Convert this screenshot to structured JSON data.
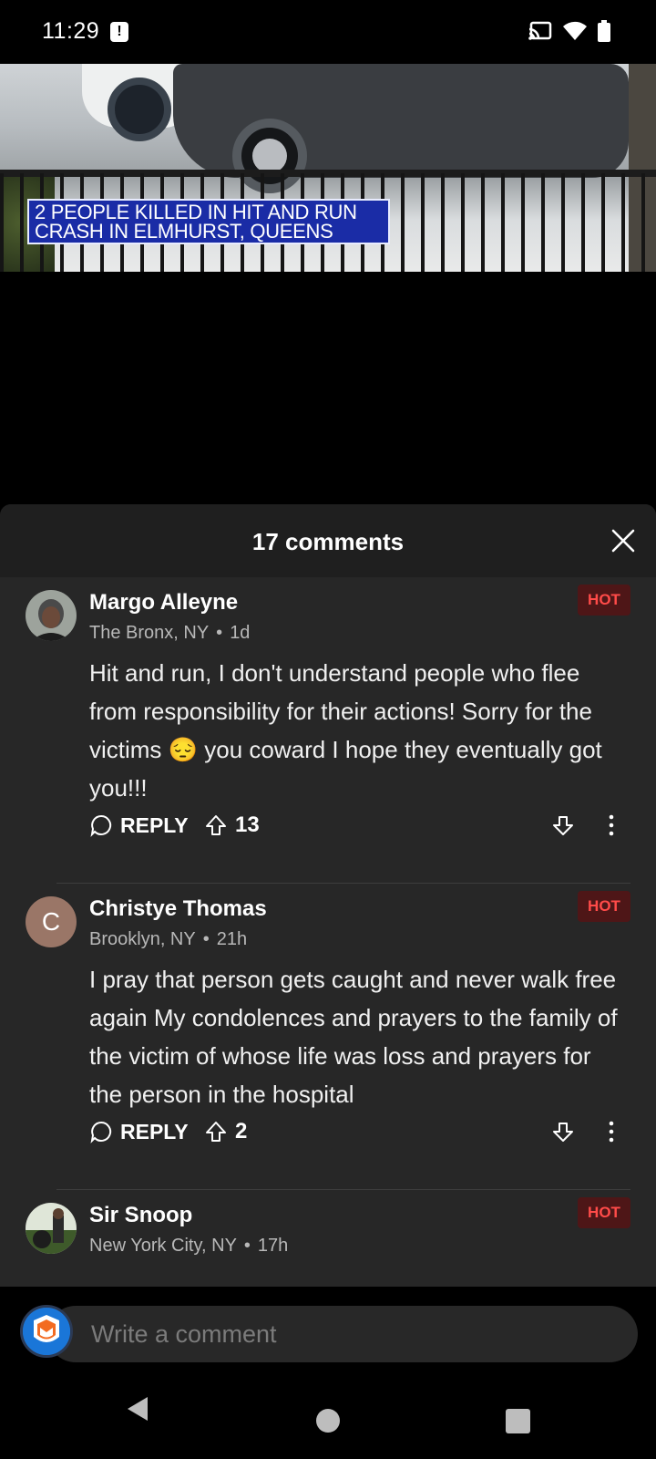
{
  "status_bar": {
    "time": "11:29",
    "icons": [
      "alert-icon",
      "cast-icon",
      "wifi-icon",
      "battery-icon"
    ]
  },
  "video": {
    "chyron_line1": "2 PEOPLE KILLED IN HIT AND RUN",
    "chyron_line2": "CRASH IN ELMHURST, QUEENS",
    "chyron_color": "#1a2ca6"
  },
  "comments_sheet": {
    "title": "17 comments",
    "comments": [
      {
        "author": "Margo Alleyne",
        "location": "The Bronx, NY",
        "age": "1d",
        "badge": "HOT",
        "text": "Hit and run, I don't understand people who flee from responsibility for their actions! Sorry for the victims 😔 you coward I hope they eventually got you!!!",
        "reply_label": "REPLY",
        "upvotes": "13"
      },
      {
        "author": "Christye Thomas",
        "avatar_letter": "C",
        "location": "Brooklyn, NY",
        "age": "21h",
        "badge": "HOT",
        "text": "I pray that person gets caught and never walk free again My condolences and prayers to the family of the victim of whose life was loss and prayers for the person in the hospital",
        "reply_label": "REPLY",
        "upvotes": "2"
      },
      {
        "author": "Sir Snoop",
        "location": "New York City, NY",
        "age": "17h",
        "badge": "HOT"
      }
    ]
  },
  "composer": {
    "placeholder": "Write a comment"
  },
  "colors": {
    "sheet_bg": "#272727",
    "hot_badge_bg": "#4e1617",
    "hot_badge_text": "#ff4b49"
  }
}
